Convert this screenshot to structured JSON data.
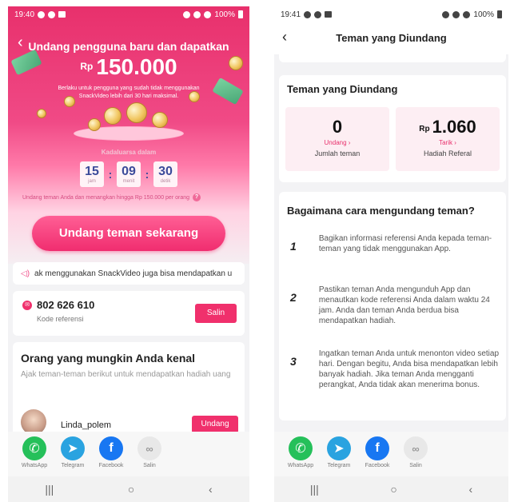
{
  "left": {
    "status": {
      "time": "19:40",
      "battery": "100%"
    },
    "hero": {
      "title": "Undang pengguna baru dan dapatkan",
      "currency": "Rp",
      "amount": "150.000",
      "note": "Berlaku untuk pengguna yang sudah tidak menggunakan SnackVideo lebih dari 30 hari maksimal."
    },
    "timer": {
      "label": "Kadaluarsa dalam",
      "hours": "15",
      "hours_unit": "jam",
      "minutes": "09",
      "minutes_unit": "menit",
      "seconds": "30",
      "seconds_unit": "detik"
    },
    "invite_note": "Undang teman Anda dan menangkan hingga Rp 150.000 per orang",
    "invite_button": "Undang teman sekarang",
    "marquee": "ak menggunakan SnackVideo juga bisa mendapatkan u",
    "referral": {
      "code": "802 626 610",
      "label": "Kode referensi",
      "copy_label": "Salin"
    },
    "people": {
      "title": "Orang yang mungkin Anda kenal",
      "subtitle": "Ajak teman-teman berikut untuk mendapatkan hadiah uang",
      "person_name": "Linda_polem",
      "invite_label": "Undang"
    }
  },
  "share": {
    "whatsapp": "WhatsApp",
    "telegram": "Telegram",
    "facebook": "Facebook",
    "copy": "Salin"
  },
  "colors": {
    "brand": "#f0306c",
    "whatsapp": "#25c05a",
    "telegram": "#2aa3e0",
    "facebook": "#1877f2",
    "copy": "#e8e8e8"
  },
  "right": {
    "status": {
      "time": "19:41",
      "battery": "100%"
    },
    "title": "Teman yang Diundang",
    "friends": {
      "title": "Teman yang Diundang",
      "count": "0",
      "count_link": "Undang ›",
      "count_caption": "Jumlah teman",
      "reward_currency": "Rp",
      "reward": "1.060",
      "reward_link": "Tarik ›",
      "reward_caption": "Hadiah Referal"
    },
    "howto": {
      "title": "Bagaimana cara mengundang teman?",
      "steps": [
        {
          "n": "1",
          "text": "Bagikan informasi referensi Anda kepada teman-teman yang tidak menggunakan App."
        },
        {
          "n": "2",
          "text": "Pastikan teman Anda mengunduh App dan menautkan kode referensi Anda dalam waktu 24 jam. Anda dan teman Anda berdua bisa mendapatkan hadiah."
        },
        {
          "n": "3",
          "text": "Ingatkan teman Anda untuk menonton video setiap hari. Dengan begitu, Anda bisa mendapatkan lebih banyak hadiah. Jika teman Anda mengganti perangkat, Anda tidak akan menerima bonus."
        }
      ]
    }
  }
}
